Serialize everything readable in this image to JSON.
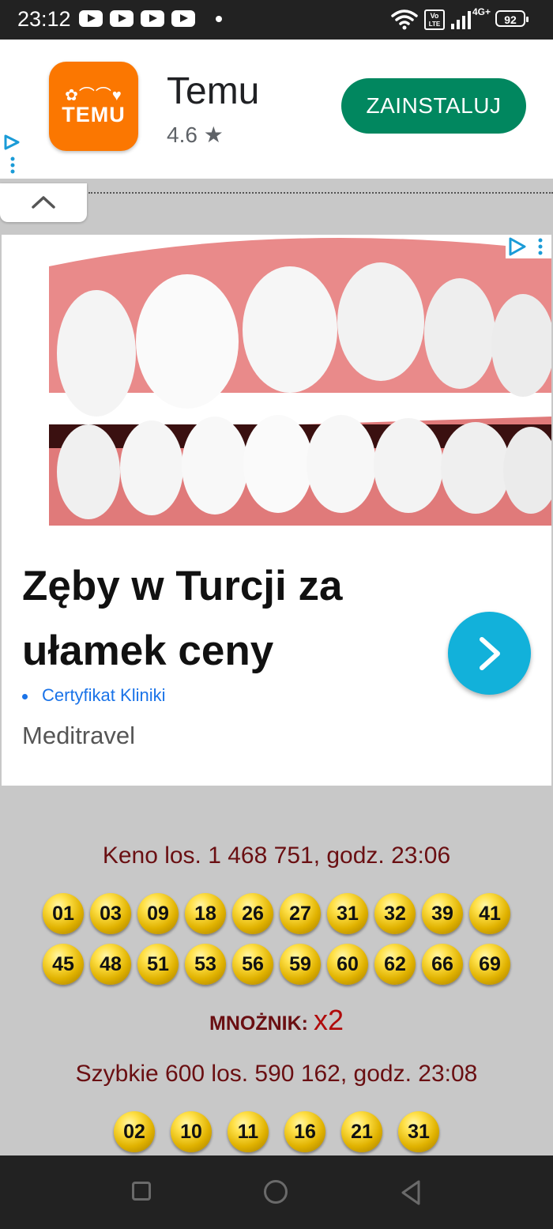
{
  "status": {
    "time": "23:12",
    "battery": "92",
    "network": "4G+"
  },
  "app_ad": {
    "name": "Temu",
    "rating": "4.6",
    "icon_text": "TEMU",
    "install_label": "ZAINSTALUJ",
    "brand_color": "#fb7701",
    "button_color": "#01875f"
  },
  "display_ad": {
    "headline": "Zęby w Turcji za ułamek ceny",
    "link_text": "Certyfikat Kliniki",
    "advertiser": "Meditravel",
    "accent": "#12b1da"
  },
  "keno": {
    "title": "Keno los. 1 468 751, godz. 23:06",
    "numbers_row1": [
      "01",
      "03",
      "09",
      "18",
      "26",
      "27",
      "31",
      "32",
      "39",
      "41"
    ],
    "numbers_row2": [
      "45",
      "48",
      "51",
      "53",
      "56",
      "59",
      "60",
      "62",
      "66",
      "69"
    ],
    "multiplier_label": "MNOŻNIK:",
    "multiplier_value": "x2"
  },
  "szybkie": {
    "title": "Szybkie 600 los. 590 162, godz. 23:08",
    "numbers": [
      "02",
      "10",
      "11",
      "16",
      "21",
      "31"
    ]
  },
  "colors": {
    "title_color": "#6a0f12",
    "multiplier_color": "#b00b0b",
    "ball_color": "#e0b200"
  }
}
